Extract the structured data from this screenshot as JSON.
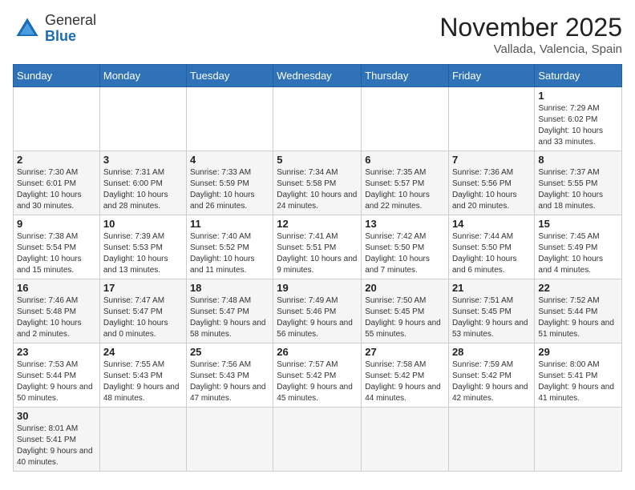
{
  "logo": {
    "general": "General",
    "blue": "Blue"
  },
  "title": "November 2025",
  "subtitle": "Vallada, Valencia, Spain",
  "weekdays": [
    "Sunday",
    "Monday",
    "Tuesday",
    "Wednesday",
    "Thursday",
    "Friday",
    "Saturday"
  ],
  "weeks": [
    [
      {
        "day": "",
        "info": ""
      },
      {
        "day": "",
        "info": ""
      },
      {
        "day": "",
        "info": ""
      },
      {
        "day": "",
        "info": ""
      },
      {
        "day": "",
        "info": ""
      },
      {
        "day": "",
        "info": ""
      },
      {
        "day": "1",
        "info": "Sunrise: 7:29 AM\nSunset: 6:02 PM\nDaylight: 10 hours and 33 minutes."
      }
    ],
    [
      {
        "day": "2",
        "info": "Sunrise: 7:30 AM\nSunset: 6:01 PM\nDaylight: 10 hours and 30 minutes."
      },
      {
        "day": "3",
        "info": "Sunrise: 7:31 AM\nSunset: 6:00 PM\nDaylight: 10 hours and 28 minutes."
      },
      {
        "day": "4",
        "info": "Sunrise: 7:33 AM\nSunset: 5:59 PM\nDaylight: 10 hours and 26 minutes."
      },
      {
        "day": "5",
        "info": "Sunrise: 7:34 AM\nSunset: 5:58 PM\nDaylight: 10 hours and 24 minutes."
      },
      {
        "day": "6",
        "info": "Sunrise: 7:35 AM\nSunset: 5:57 PM\nDaylight: 10 hours and 22 minutes."
      },
      {
        "day": "7",
        "info": "Sunrise: 7:36 AM\nSunset: 5:56 PM\nDaylight: 10 hours and 20 minutes."
      },
      {
        "day": "8",
        "info": "Sunrise: 7:37 AM\nSunset: 5:55 PM\nDaylight: 10 hours and 18 minutes."
      }
    ],
    [
      {
        "day": "9",
        "info": "Sunrise: 7:38 AM\nSunset: 5:54 PM\nDaylight: 10 hours and 15 minutes."
      },
      {
        "day": "10",
        "info": "Sunrise: 7:39 AM\nSunset: 5:53 PM\nDaylight: 10 hours and 13 minutes."
      },
      {
        "day": "11",
        "info": "Sunrise: 7:40 AM\nSunset: 5:52 PM\nDaylight: 10 hours and 11 minutes."
      },
      {
        "day": "12",
        "info": "Sunrise: 7:41 AM\nSunset: 5:51 PM\nDaylight: 10 hours and 9 minutes."
      },
      {
        "day": "13",
        "info": "Sunrise: 7:42 AM\nSunset: 5:50 PM\nDaylight: 10 hours and 7 minutes."
      },
      {
        "day": "14",
        "info": "Sunrise: 7:44 AM\nSunset: 5:50 PM\nDaylight: 10 hours and 6 minutes."
      },
      {
        "day": "15",
        "info": "Sunrise: 7:45 AM\nSunset: 5:49 PM\nDaylight: 10 hours and 4 minutes."
      }
    ],
    [
      {
        "day": "16",
        "info": "Sunrise: 7:46 AM\nSunset: 5:48 PM\nDaylight: 10 hours and 2 minutes."
      },
      {
        "day": "17",
        "info": "Sunrise: 7:47 AM\nSunset: 5:47 PM\nDaylight: 10 hours and 0 minutes."
      },
      {
        "day": "18",
        "info": "Sunrise: 7:48 AM\nSunset: 5:47 PM\nDaylight: 9 hours and 58 minutes."
      },
      {
        "day": "19",
        "info": "Sunrise: 7:49 AM\nSunset: 5:46 PM\nDaylight: 9 hours and 56 minutes."
      },
      {
        "day": "20",
        "info": "Sunrise: 7:50 AM\nSunset: 5:45 PM\nDaylight: 9 hours and 55 minutes."
      },
      {
        "day": "21",
        "info": "Sunrise: 7:51 AM\nSunset: 5:45 PM\nDaylight: 9 hours and 53 minutes."
      },
      {
        "day": "22",
        "info": "Sunrise: 7:52 AM\nSunset: 5:44 PM\nDaylight: 9 hours and 51 minutes."
      }
    ],
    [
      {
        "day": "23",
        "info": "Sunrise: 7:53 AM\nSunset: 5:44 PM\nDaylight: 9 hours and 50 minutes."
      },
      {
        "day": "24",
        "info": "Sunrise: 7:55 AM\nSunset: 5:43 PM\nDaylight: 9 hours and 48 minutes."
      },
      {
        "day": "25",
        "info": "Sunrise: 7:56 AM\nSunset: 5:43 PM\nDaylight: 9 hours and 47 minutes."
      },
      {
        "day": "26",
        "info": "Sunrise: 7:57 AM\nSunset: 5:42 PM\nDaylight: 9 hours and 45 minutes."
      },
      {
        "day": "27",
        "info": "Sunrise: 7:58 AM\nSunset: 5:42 PM\nDaylight: 9 hours and 44 minutes."
      },
      {
        "day": "28",
        "info": "Sunrise: 7:59 AM\nSunset: 5:42 PM\nDaylight: 9 hours and 42 minutes."
      },
      {
        "day": "29",
        "info": "Sunrise: 8:00 AM\nSunset: 5:41 PM\nDaylight: 9 hours and 41 minutes."
      }
    ],
    [
      {
        "day": "30",
        "info": "Sunrise: 8:01 AM\nSunset: 5:41 PM\nDaylight: 9 hours and 40 minutes."
      },
      {
        "day": "",
        "info": ""
      },
      {
        "day": "",
        "info": ""
      },
      {
        "day": "",
        "info": ""
      },
      {
        "day": "",
        "info": ""
      },
      {
        "day": "",
        "info": ""
      },
      {
        "day": "",
        "info": ""
      }
    ]
  ]
}
